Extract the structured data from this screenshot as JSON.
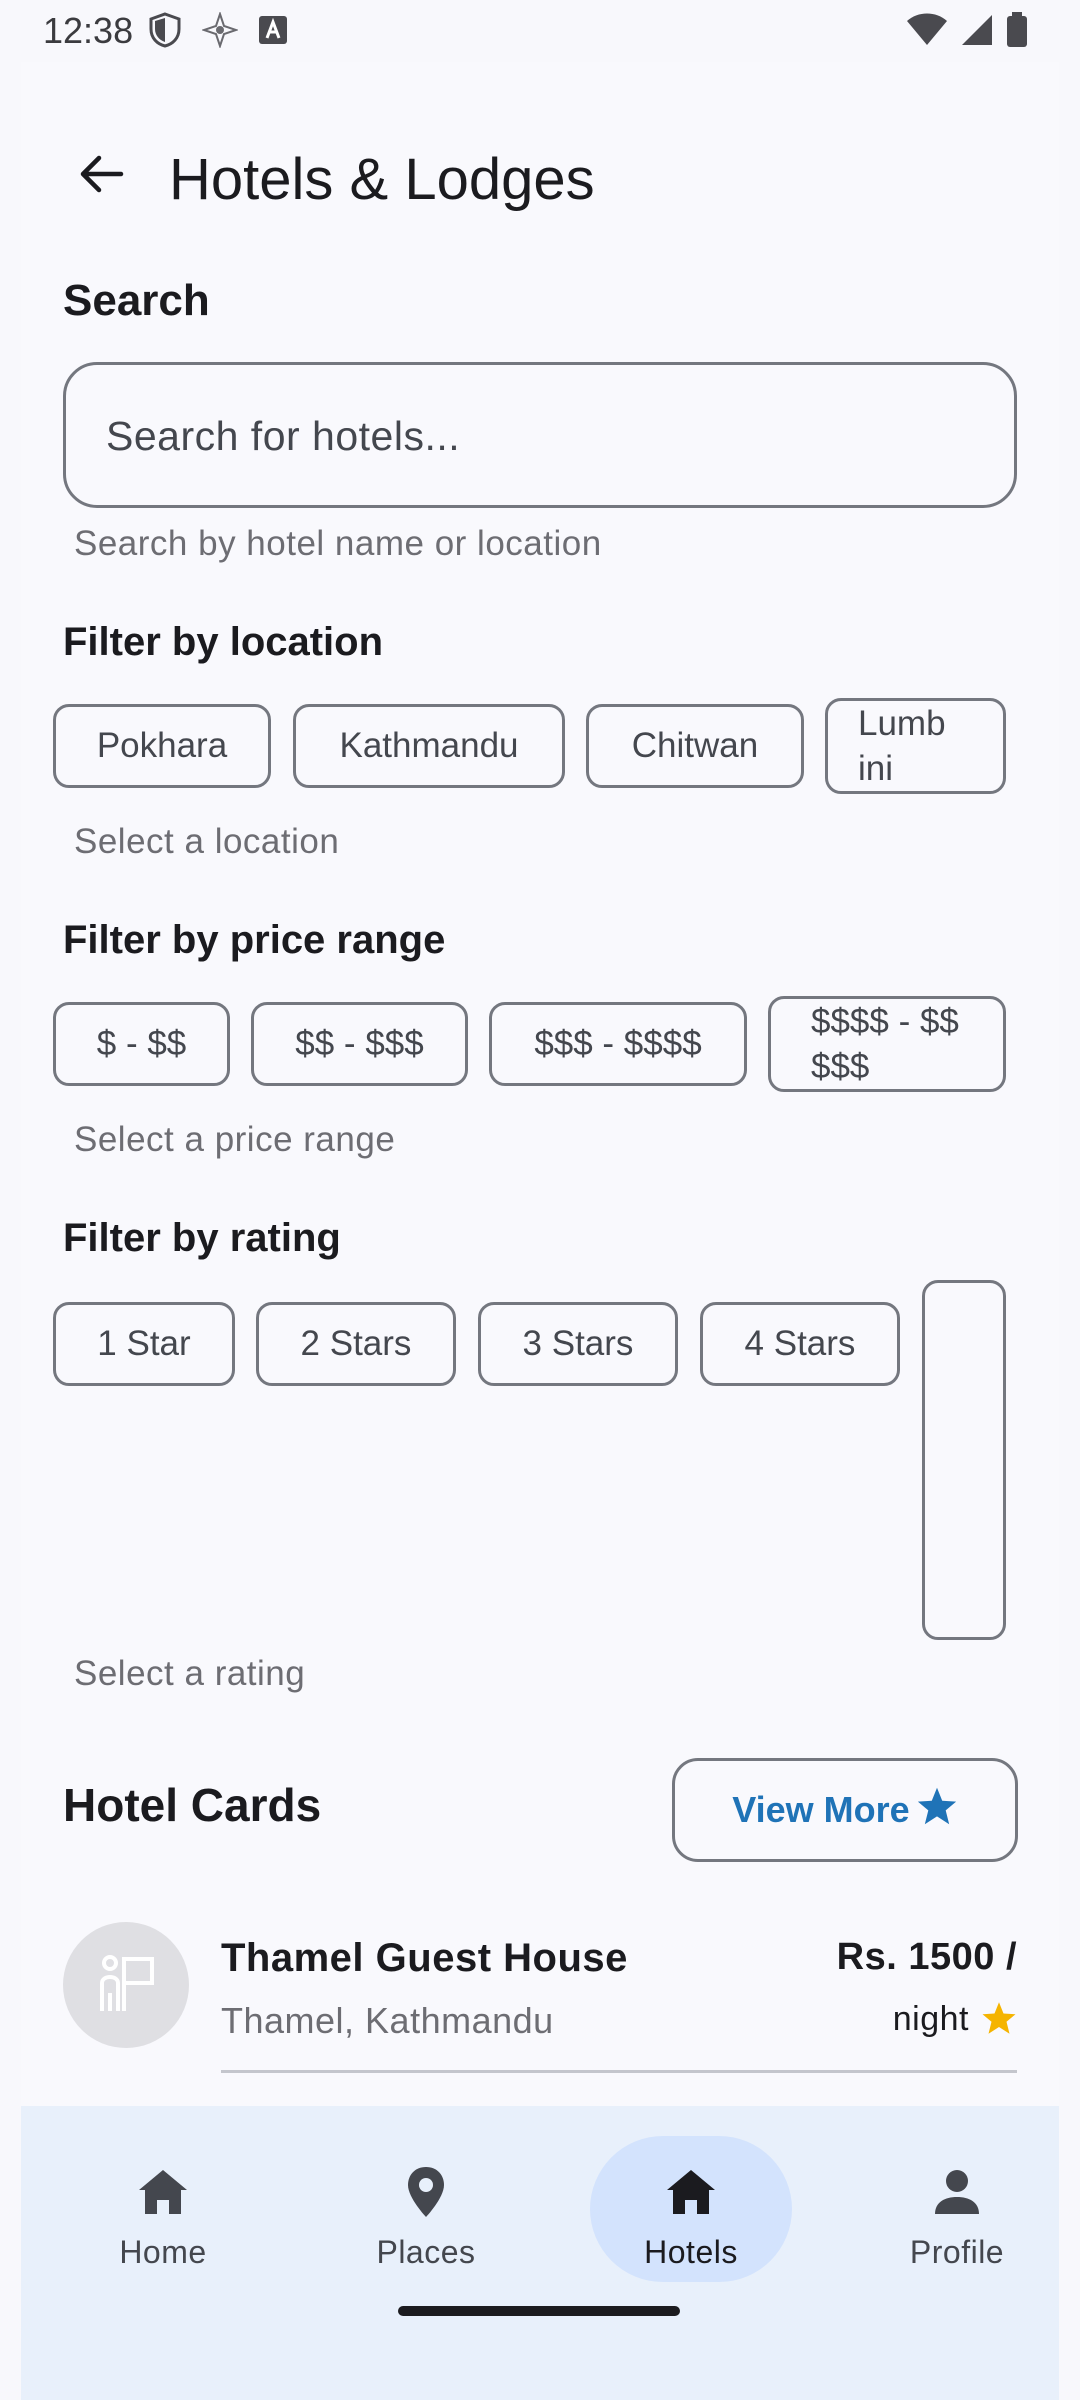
{
  "status_bar": {
    "time": "12:38",
    "left_icons": [
      "shield-icon",
      "sparkle-icon",
      "font-icon"
    ],
    "right_icons": [
      "wifi-icon",
      "signal-icon",
      "battery-icon"
    ]
  },
  "app_bar": {
    "title": "Hotels & Lodges",
    "back_icon": "arrow-back-icon"
  },
  "search": {
    "section_title": "Search",
    "placeholder": "Search for hotels...",
    "helper": "Search by hotel name or location"
  },
  "location_filter": {
    "title": "Filter by location",
    "chips": [
      "Pokhara",
      "Kathmandu",
      "Chitwan",
      "Lumb ini"
    ],
    "helper": "Select a location"
  },
  "price_filter": {
    "title": "Filter by price range",
    "chips": [
      "$ - $$",
      "$$ - $$$",
      "$$$ - $$$$",
      "$$$$ - $$ $$$"
    ],
    "helper": "Select a price range"
  },
  "rating_filter": {
    "title": "Filter by rating",
    "chips": [
      "1 Star",
      "2 Stars",
      "3 Stars",
      "4 Stars",
      ""
    ],
    "helper": "Select a rating"
  },
  "hotel_cards": {
    "title": "Hotel Cards",
    "view_more_label": "View More",
    "view_more_icon": "star-icon",
    "accent_color": "#1f73b7",
    "items": [
      {
        "name": "Thamel Guest House",
        "location": "Thamel, Kathmandu",
        "price": "Rs. 1500 /",
        "per": "night",
        "icon": "hotel-flag-icon"
      }
    ]
  },
  "bottom_nav": {
    "items": [
      {
        "label": "Home",
        "icon": "home-icon",
        "active": false
      },
      {
        "label": "Places",
        "icon": "place-pin-icon",
        "active": false
      },
      {
        "label": "Hotels",
        "icon": "home-icon",
        "active": true
      },
      {
        "label": "Profile",
        "icon": "person-icon",
        "active": false
      }
    ],
    "active_color": "#d3e3fd"
  }
}
